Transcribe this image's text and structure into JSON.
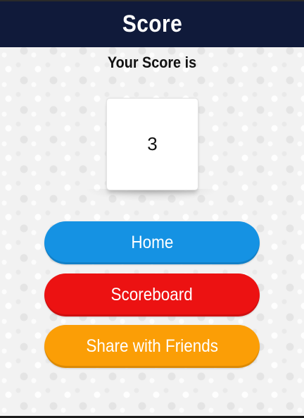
{
  "header": {
    "title": "Score"
  },
  "score": {
    "label": "Your Score is",
    "value": "3"
  },
  "buttons": {
    "home": "Home",
    "scoreboard": "Scoreboard",
    "share": "Share with Friends"
  },
  "colors": {
    "header_bg": "#101a3a",
    "home": "#1592e3",
    "scoreboard": "#ec1212",
    "share": "#fb9e06"
  }
}
